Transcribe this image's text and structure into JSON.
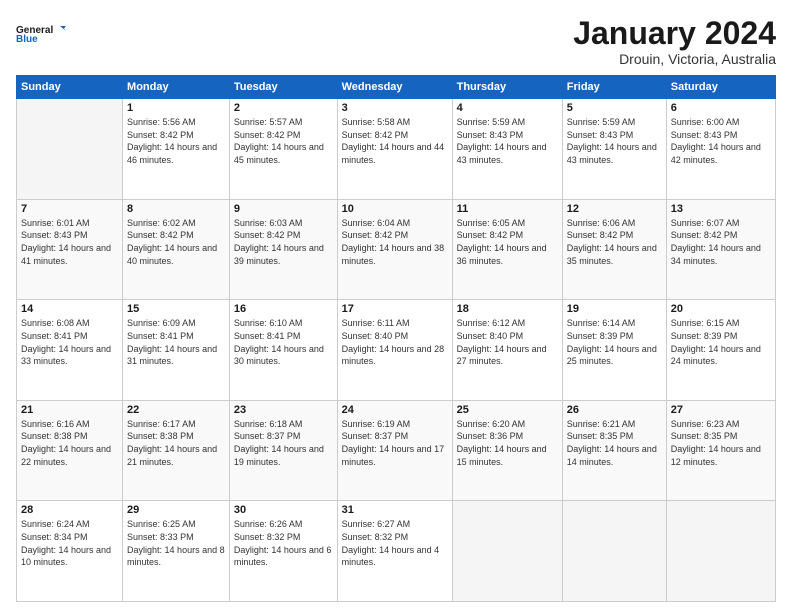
{
  "logo": {
    "line1": "General",
    "line2": "Blue"
  },
  "title": "January 2024",
  "subtitle": "Drouin, Victoria, Australia",
  "header": {
    "days": [
      "Sunday",
      "Monday",
      "Tuesday",
      "Wednesday",
      "Thursday",
      "Friday",
      "Saturday"
    ]
  },
  "weeks": [
    [
      {
        "num": "",
        "sunrise": "",
        "sunset": "",
        "daylight": ""
      },
      {
        "num": "1",
        "sunrise": "Sunrise: 5:56 AM",
        "sunset": "Sunset: 8:42 PM",
        "daylight": "Daylight: 14 hours and 46 minutes."
      },
      {
        "num": "2",
        "sunrise": "Sunrise: 5:57 AM",
        "sunset": "Sunset: 8:42 PM",
        "daylight": "Daylight: 14 hours and 45 minutes."
      },
      {
        "num": "3",
        "sunrise": "Sunrise: 5:58 AM",
        "sunset": "Sunset: 8:42 PM",
        "daylight": "Daylight: 14 hours and 44 minutes."
      },
      {
        "num": "4",
        "sunrise": "Sunrise: 5:59 AM",
        "sunset": "Sunset: 8:43 PM",
        "daylight": "Daylight: 14 hours and 43 minutes."
      },
      {
        "num": "5",
        "sunrise": "Sunrise: 5:59 AM",
        "sunset": "Sunset: 8:43 PM",
        "daylight": "Daylight: 14 hours and 43 minutes."
      },
      {
        "num": "6",
        "sunrise": "Sunrise: 6:00 AM",
        "sunset": "Sunset: 8:43 PM",
        "daylight": "Daylight: 14 hours and 42 minutes."
      }
    ],
    [
      {
        "num": "7",
        "sunrise": "Sunrise: 6:01 AM",
        "sunset": "Sunset: 8:43 PM",
        "daylight": "Daylight: 14 hours and 41 minutes."
      },
      {
        "num": "8",
        "sunrise": "Sunrise: 6:02 AM",
        "sunset": "Sunset: 8:42 PM",
        "daylight": "Daylight: 14 hours and 40 minutes."
      },
      {
        "num": "9",
        "sunrise": "Sunrise: 6:03 AM",
        "sunset": "Sunset: 8:42 PM",
        "daylight": "Daylight: 14 hours and 39 minutes."
      },
      {
        "num": "10",
        "sunrise": "Sunrise: 6:04 AM",
        "sunset": "Sunset: 8:42 PM",
        "daylight": "Daylight: 14 hours and 38 minutes."
      },
      {
        "num": "11",
        "sunrise": "Sunrise: 6:05 AM",
        "sunset": "Sunset: 8:42 PM",
        "daylight": "Daylight: 14 hours and 36 minutes."
      },
      {
        "num": "12",
        "sunrise": "Sunrise: 6:06 AM",
        "sunset": "Sunset: 8:42 PM",
        "daylight": "Daylight: 14 hours and 35 minutes."
      },
      {
        "num": "13",
        "sunrise": "Sunrise: 6:07 AM",
        "sunset": "Sunset: 8:42 PM",
        "daylight": "Daylight: 14 hours and 34 minutes."
      }
    ],
    [
      {
        "num": "14",
        "sunrise": "Sunrise: 6:08 AM",
        "sunset": "Sunset: 8:41 PM",
        "daylight": "Daylight: 14 hours and 33 minutes."
      },
      {
        "num": "15",
        "sunrise": "Sunrise: 6:09 AM",
        "sunset": "Sunset: 8:41 PM",
        "daylight": "Daylight: 14 hours and 31 minutes."
      },
      {
        "num": "16",
        "sunrise": "Sunrise: 6:10 AM",
        "sunset": "Sunset: 8:41 PM",
        "daylight": "Daylight: 14 hours and 30 minutes."
      },
      {
        "num": "17",
        "sunrise": "Sunrise: 6:11 AM",
        "sunset": "Sunset: 8:40 PM",
        "daylight": "Daylight: 14 hours and 28 minutes."
      },
      {
        "num": "18",
        "sunrise": "Sunrise: 6:12 AM",
        "sunset": "Sunset: 8:40 PM",
        "daylight": "Daylight: 14 hours and 27 minutes."
      },
      {
        "num": "19",
        "sunrise": "Sunrise: 6:14 AM",
        "sunset": "Sunset: 8:39 PM",
        "daylight": "Daylight: 14 hours and 25 minutes."
      },
      {
        "num": "20",
        "sunrise": "Sunrise: 6:15 AM",
        "sunset": "Sunset: 8:39 PM",
        "daylight": "Daylight: 14 hours and 24 minutes."
      }
    ],
    [
      {
        "num": "21",
        "sunrise": "Sunrise: 6:16 AM",
        "sunset": "Sunset: 8:38 PM",
        "daylight": "Daylight: 14 hours and 22 minutes."
      },
      {
        "num": "22",
        "sunrise": "Sunrise: 6:17 AM",
        "sunset": "Sunset: 8:38 PM",
        "daylight": "Daylight: 14 hours and 21 minutes."
      },
      {
        "num": "23",
        "sunrise": "Sunrise: 6:18 AM",
        "sunset": "Sunset: 8:37 PM",
        "daylight": "Daylight: 14 hours and 19 minutes."
      },
      {
        "num": "24",
        "sunrise": "Sunrise: 6:19 AM",
        "sunset": "Sunset: 8:37 PM",
        "daylight": "Daylight: 14 hours and 17 minutes."
      },
      {
        "num": "25",
        "sunrise": "Sunrise: 6:20 AM",
        "sunset": "Sunset: 8:36 PM",
        "daylight": "Daylight: 14 hours and 15 minutes."
      },
      {
        "num": "26",
        "sunrise": "Sunrise: 6:21 AM",
        "sunset": "Sunset: 8:35 PM",
        "daylight": "Daylight: 14 hours and 14 minutes."
      },
      {
        "num": "27",
        "sunrise": "Sunrise: 6:23 AM",
        "sunset": "Sunset: 8:35 PM",
        "daylight": "Daylight: 14 hours and 12 minutes."
      }
    ],
    [
      {
        "num": "28",
        "sunrise": "Sunrise: 6:24 AM",
        "sunset": "Sunset: 8:34 PM",
        "daylight": "Daylight: 14 hours and 10 minutes."
      },
      {
        "num": "29",
        "sunrise": "Sunrise: 6:25 AM",
        "sunset": "Sunset: 8:33 PM",
        "daylight": "Daylight: 14 hours and 8 minutes."
      },
      {
        "num": "30",
        "sunrise": "Sunrise: 6:26 AM",
        "sunset": "Sunset: 8:32 PM",
        "daylight": "Daylight: 14 hours and 6 minutes."
      },
      {
        "num": "31",
        "sunrise": "Sunrise: 6:27 AM",
        "sunset": "Sunset: 8:32 PM",
        "daylight": "Daylight: 14 hours and 4 minutes."
      },
      {
        "num": "",
        "sunrise": "",
        "sunset": "",
        "daylight": ""
      },
      {
        "num": "",
        "sunrise": "",
        "sunset": "",
        "daylight": ""
      },
      {
        "num": "",
        "sunrise": "",
        "sunset": "",
        "daylight": ""
      }
    ]
  ]
}
